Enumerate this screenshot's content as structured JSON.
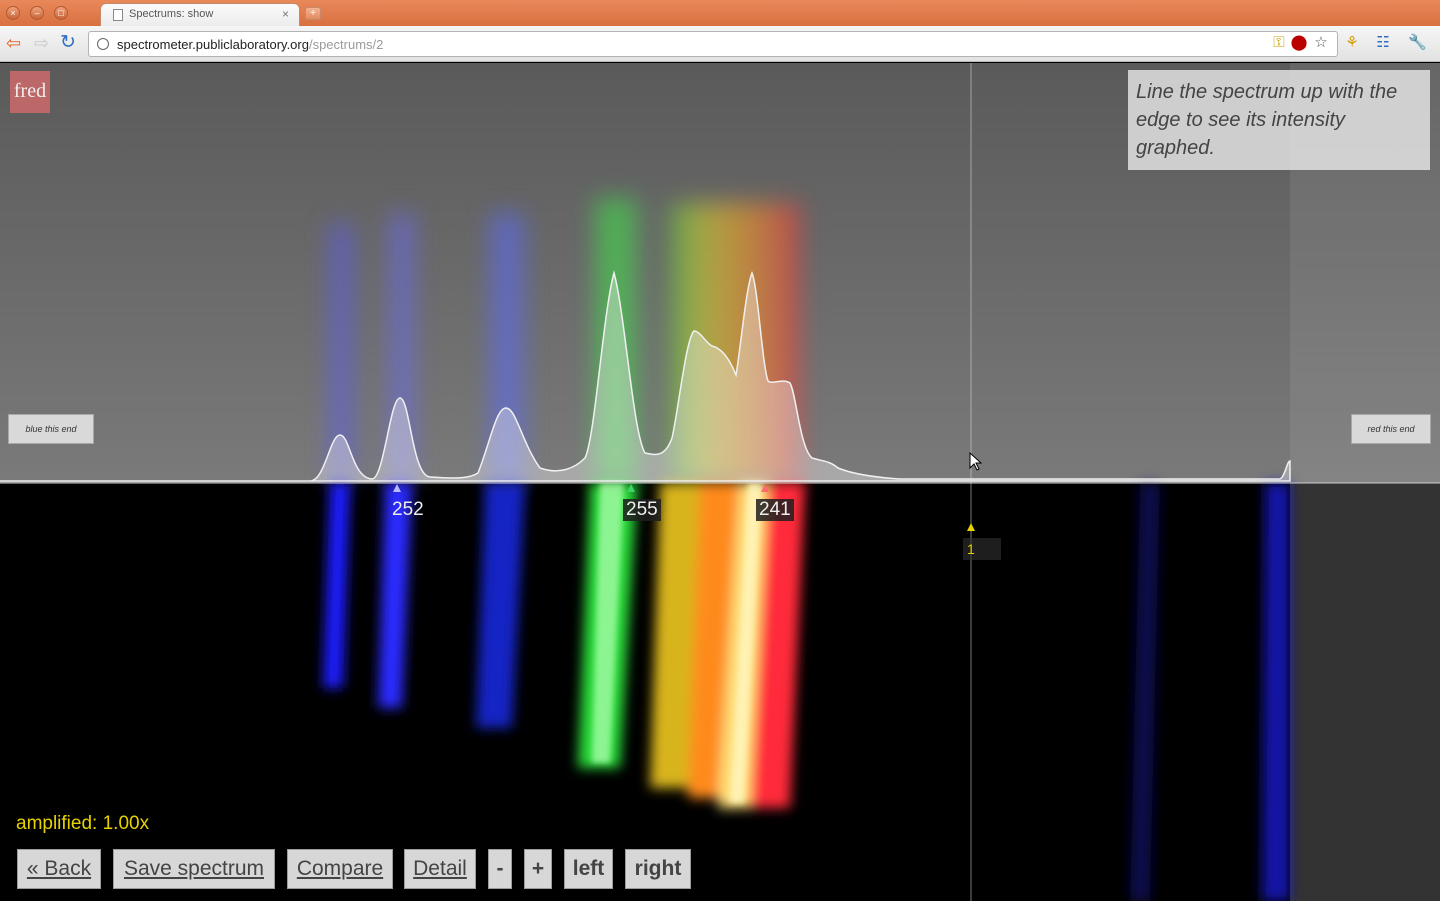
{
  "browser": {
    "tab_title": "Spectrums: show",
    "url_host": "spectrometer.publiclaboratory.org",
    "url_path": "/spectrums/2",
    "window_buttons": [
      "×",
      "–",
      "□"
    ],
    "new_tab": "+"
  },
  "page": {
    "logo_text": "fred",
    "help_text": "Line the spectrum up with the edge to see its intensity graphed.",
    "blue_end_label": "blue this end",
    "red_end_label": "red this end",
    "peaks": [
      {
        "label": "252",
        "color": "#b9b9ff"
      },
      {
        "label": "255",
        "color": "#3fd46a"
      },
      {
        "label": "241",
        "color": "#ff6a6a"
      }
    ],
    "cursor_label": "1",
    "amplified_text": "amplified: 1.00x",
    "buttons": {
      "back": "« Back",
      "save": "Save spectrum",
      "compare": "Compare",
      "detail": "Detail",
      "minus": "-",
      "plus": "+",
      "left": "left",
      "right": "right"
    }
  },
  "colors": {
    "titlebar": "#d8703f",
    "amplified_text": "#e6d200",
    "graph_bg": "#6a6a6a"
  }
}
